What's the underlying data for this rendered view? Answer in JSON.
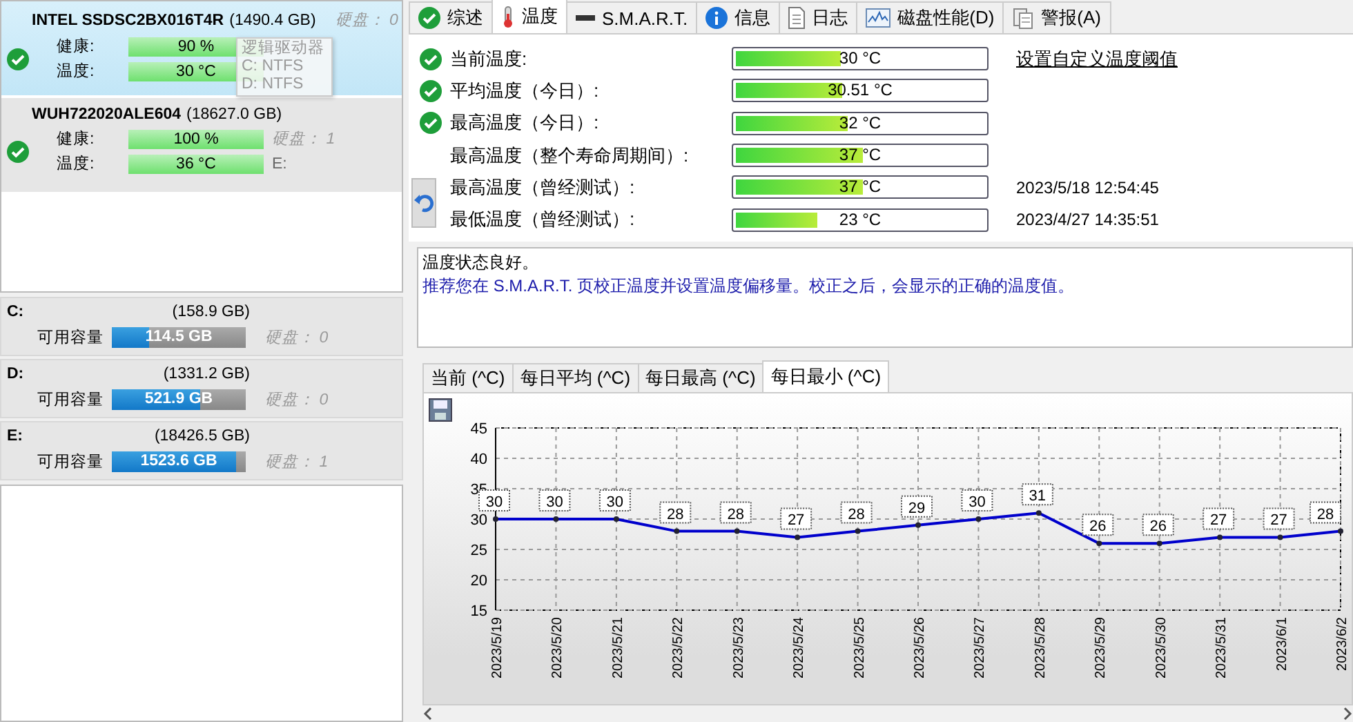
{
  "disks": [
    {
      "name": "INTEL SSDSC2BX016T4R",
      "size": "(1490.4 GB)",
      "disk_label": "硬盘： 0",
      "selected": true,
      "ok": true,
      "health_label": "健康:",
      "health": "90 %",
      "temp_label": "温度:",
      "temperature": "30 °C"
    },
    {
      "name": "WUH722020ALE604",
      "size": "(18627.0 GB)",
      "disk_label": "硬盘： 1",
      "selected": false,
      "ok": true,
      "health_label": "健康:",
      "health": "100 %",
      "temp_label": "温度:",
      "temperature": "36 °C",
      "drives": [
        "E:"
      ]
    }
  ],
  "tooltip": {
    "title": "逻辑驱动器",
    "lines": [
      "C: NTFS",
      "D: NTFS"
    ]
  },
  "volumes": [
    {
      "letter": "C:",
      "size": "(158.9 GB)",
      "label": "可用容量",
      "free": "114.5 GB",
      "level": 0.28,
      "disk_label": "硬盘： 0"
    },
    {
      "letter": "D:",
      "size": "(1331.2 GB)",
      "label": "可用容量",
      "free": "521.9 GB",
      "level": 0.66,
      "disk_label": "硬盘： 0"
    },
    {
      "letter": "E:",
      "size": "(18426.5 GB)",
      "label": "可用容量",
      "free": "1523.6 GB",
      "level": 0.93,
      "disk_label": "硬盘： 1"
    }
  ],
  "tabs": [
    {
      "label": "综述",
      "kind": "check",
      "selected": false
    },
    {
      "label": "温度",
      "kind": "thermometer",
      "selected": true
    },
    {
      "label": "S.M.A.R.T.",
      "kind": "dash",
      "selected": false
    },
    {
      "label": "信息",
      "kind": "info",
      "selected": false
    },
    {
      "label": "日志",
      "kind": "document",
      "selected": false
    },
    {
      "label": "磁盘性能(D)",
      "kind": "graph",
      "selected": false
    },
    {
      "label": "警报(A)",
      "kind": "clipboard",
      "selected": false
    }
  ],
  "temperatures": [
    {
      "label": "当前温度:",
      "ok": true,
      "value": "30 °C",
      "level": 0.42,
      "link": "设置自定义温度阈值"
    },
    {
      "label": "平均温度（今日）:",
      "ok": true,
      "value": "30.51 °C",
      "level": 0.43
    },
    {
      "label": "最高温度（今日）:",
      "ok": true,
      "value": "32 °C",
      "level": 0.45
    },
    {
      "label": "最高温度（整个寿命周期间）:",
      "ok": false,
      "value": "37 °C",
      "level": 0.51
    },
    {
      "label": "最高温度（曾经测试）:",
      "ok": false,
      "value": "37 °C",
      "level": 0.51,
      "time": "2023/5/18 12:54:45"
    },
    {
      "label": "最低温度（曾经测试）:",
      "ok": false,
      "value": "23 °C",
      "level": 0.33,
      "time": "2023/4/27 14:35:51"
    }
  ],
  "messages": [
    {
      "kind": "status",
      "text": "温度状态良好。"
    },
    {
      "kind": "hint",
      "text": "推荐您在 S.M.A.R.T. 页校正温度并设置温度偏移量。校正之后，会显示的正确的温度值。"
    }
  ],
  "chart_tabs": [
    {
      "label": "当前 (^C)",
      "selected": false
    },
    {
      "label": "每日平均 (^C)",
      "selected": false
    },
    {
      "label": "每日最高 (^C)",
      "selected": false
    },
    {
      "label": "每日最小 (^C)",
      "selected": true
    }
  ],
  "chart_data": {
    "type": "line",
    "categories": [
      "2023/5/19",
      "2023/5/20",
      "2023/5/21",
      "2023/5/22",
      "2023/5/23",
      "2023/5/24",
      "2023/5/25",
      "2023/5/26",
      "2023/5/27",
      "2023/5/28",
      "2023/5/29",
      "2023/5/30",
      "2023/5/31",
      "2023/6/1",
      "2023/6/2"
    ],
    "series": [
      {
        "color": "#0000cc",
        "marker": true,
        "values": [
          30,
          30,
          30,
          28,
          28,
          27,
          28,
          29,
          30,
          31,
          26,
          26,
          27,
          27,
          28
        ]
      }
    ],
    "ylim": [
      15,
      45
    ],
    "yticks": [
      15,
      20,
      25,
      30,
      35,
      40,
      45
    ],
    "grid": true,
    "data_labels": true
  }
}
